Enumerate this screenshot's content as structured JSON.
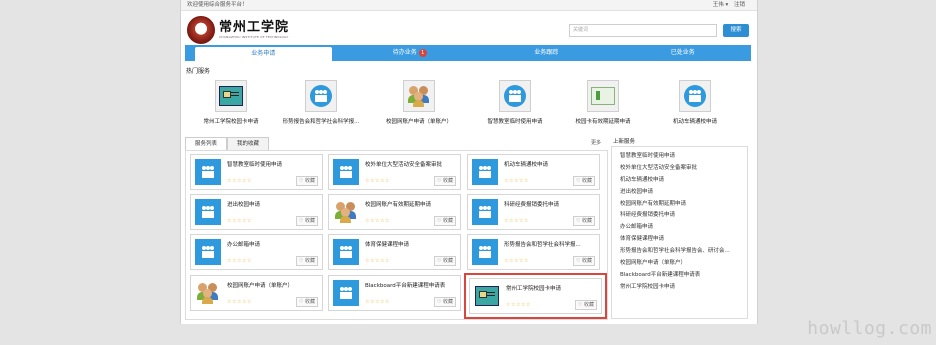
{
  "topbar": {
    "welcome": "欢迎使用综合服务平台！",
    "user": "王伟 ▾",
    "logout": "注销"
  },
  "logo": {
    "name_cn": "常州工学院",
    "name_en": "CHANGZHOU INSTITUTE OF TECHNOLOGY"
  },
  "search": {
    "placeholder": "关键词",
    "button": "搜索"
  },
  "nav": {
    "tabs": [
      {
        "label": "业务申请"
      },
      {
        "label": "待办业务",
        "badge": "1"
      },
      {
        "label": "业务跟踪"
      },
      {
        "label": "已处业务"
      }
    ]
  },
  "hot": {
    "title": "热门服务",
    "items": [
      {
        "label": "常州工学院校园卡申请",
        "icon": "campus-card-icon"
      },
      {
        "label": "形势报告会和哲学社会科学报...",
        "icon": "people-group-icon"
      },
      {
        "label": "校园网账户申请（单账户）",
        "icon": "users-icon"
      },
      {
        "label": "智慧教室临时使用申请",
        "icon": "people-group-icon"
      },
      {
        "label": "校园卡有效期延期申请",
        "icon": "green-card-icon"
      },
      {
        "label": "机动车辆通校申请",
        "icon": "people-group-icon"
      }
    ]
  },
  "tabs": {
    "list": "服务列表",
    "favorites": "我的收藏",
    "more": "更多"
  },
  "services": [
    {
      "name": "智慧教室临时使用申请",
      "stars": "☆☆☆☆☆",
      "fav": "♡ 收藏",
      "icon": "people-group-icon"
    },
    {
      "name": "校外单位大型活动安全备案审批",
      "stars": "☆☆☆☆☆",
      "fav": "♡ 收藏",
      "icon": "people-group-icon"
    },
    {
      "name": "机动车辆通校申请",
      "stars": "☆☆☆☆☆",
      "fav": "♡ 收藏",
      "icon": "people-group-icon"
    },
    {
      "name": "进出校园申请",
      "stars": "☆☆☆☆☆",
      "fav": "♡ 收藏",
      "icon": "people-group-icon"
    },
    {
      "name": "校园网账户有效期延期申请",
      "stars": "☆☆☆☆☆",
      "fav": "♡ 收藏",
      "icon": "users-icon"
    },
    {
      "name": "科研经费报销委托申请",
      "stars": "☆☆☆☆☆",
      "fav": "♡ 收藏",
      "icon": "people-group-icon"
    },
    {
      "name": "办公邮箱申请",
      "stars": "☆☆☆☆☆",
      "fav": "♡ 收藏",
      "icon": "people-group-icon"
    },
    {
      "name": "体育保健课程申请",
      "stars": "☆☆☆☆☆",
      "fav": "♡ 收藏",
      "icon": "people-group-icon"
    },
    {
      "name": "形势报告会和哲学社会科学报...",
      "stars": "☆☆☆☆☆",
      "fav": "♡ 收藏",
      "icon": "people-group-icon"
    },
    {
      "name": "校园网账户申请（单账户）",
      "stars": "☆☆☆☆☆",
      "fav": "♡ 收藏",
      "icon": "users-icon"
    },
    {
      "name": "Blackboard平台新建课程申请表",
      "stars": "☆☆☆☆☆",
      "fav": "♡ 收藏",
      "icon": "people-group-icon"
    },
    {
      "name": "常州工学院校园卡申请",
      "stars": "☆☆☆☆☆",
      "fav": "♡ 收藏",
      "icon": "campus-card-icon"
    }
  ],
  "latest": {
    "title": "上新服务",
    "items": [
      "智慧教室临时使用申请",
      "校外单位大型活动安全备案审批",
      "机动车辆通校申请",
      "进出校园申请",
      "校园网账户有效期延期申请",
      "科研经费报销委托申请",
      "办公邮箱申请",
      "体育保健课程申请",
      "形势报告会和哲学社会科学报告会、研讨会...",
      "校园网账户申请（单账户）",
      "Blackboard平台新建课程申请表",
      "常州工学院校园卡申请"
    ]
  },
  "watermark": "howllog.com",
  "colors": {
    "accent": "#3b9be0",
    "badge": "#d9433b",
    "highlight": "#d9463d",
    "icon_bg": "#2e99dc"
  }
}
